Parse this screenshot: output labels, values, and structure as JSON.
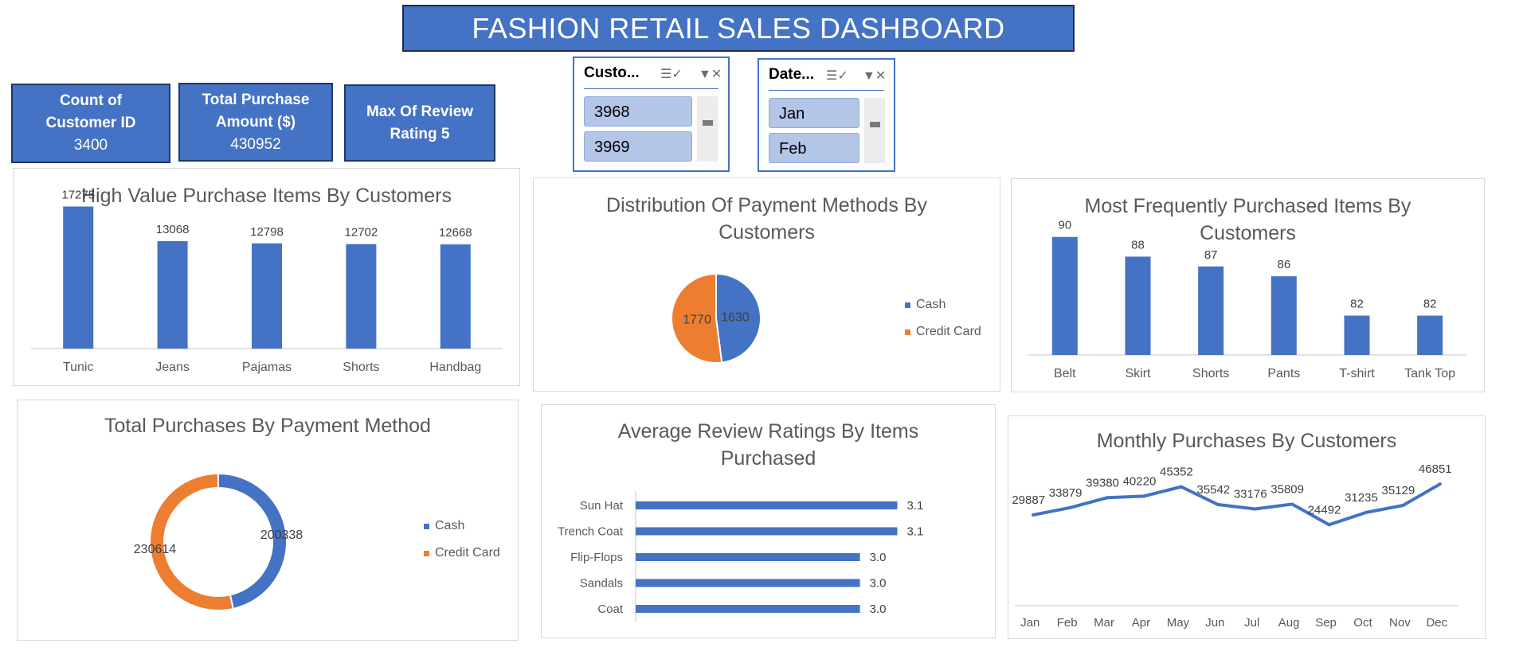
{
  "header": {
    "title": "FASHION RETAIL SALES DASHBOARD"
  },
  "kpis": [
    {
      "line1": "Count of",
      "line2": "Customer ID",
      "value": "3400"
    },
    {
      "line1": "Total Purchase",
      "line2": "Amount ($)",
      "value": "430952"
    },
    {
      "line1": "Max Of Review",
      "line2": "Rating  5"
    }
  ],
  "slicers": [
    {
      "title": "Custo...",
      "items": [
        "3968",
        "3969"
      ]
    },
    {
      "title": "Date...",
      "items": [
        "Jan",
        "Feb"
      ]
    }
  ],
  "icons": [
    "multi-select-icon",
    "clear-filter-icon"
  ],
  "colors": {
    "blue": "#4472c4",
    "orange": "#ed7d31",
    "slicer_item": "#b4c6e7"
  },
  "chart_data": [
    {
      "id": "high-value",
      "type": "bar",
      "title": "High Value Purchase Items By Customers",
      "categories": [
        "Tunic",
        "Jeans",
        "Pajamas",
        "Shorts",
        "Handbag"
      ],
      "values": [
        17275,
        13068,
        12798,
        12702,
        12668
      ],
      "ylim": [
        0,
        18000
      ]
    },
    {
      "id": "payment-dist",
      "type": "pie",
      "title_lines": [
        "Distribution Of Payment Methods By",
        "Customers"
      ],
      "labels": [
        "Cash",
        "Credit Card"
      ],
      "values": [
        1630,
        1770
      ],
      "legend": "right"
    },
    {
      "id": "frequent-items",
      "type": "bar",
      "title_lines": [
        "Most Frequently Purchased Items By",
        "Customers"
      ],
      "categories": [
        "Belt",
        "Skirt",
        "Shorts",
        "Pants",
        "T-shirt",
        "Tank Top"
      ],
      "values": [
        90,
        88,
        87,
        86,
        82,
        82
      ],
      "ylim": [
        78,
        92
      ]
    },
    {
      "id": "payment-totals",
      "type": "pie",
      "subtype": "donut",
      "title": "Total Purchases By Payment Method",
      "labels": [
        "Cash",
        "Credit Card"
      ],
      "values": [
        200338,
        230614
      ],
      "legend": "right"
    },
    {
      "id": "avg-ratings",
      "type": "bar",
      "orientation": "horizontal",
      "title_lines": [
        "Average Review Ratings By Items",
        "Purchased"
      ],
      "categories": [
        "Sun Hat",
        "Trench Coat",
        "Flip-Flops",
        "Sandals",
        "Coat"
      ],
      "values": [
        3.1,
        3.1,
        3.0,
        3.0,
        3.0
      ],
      "value_labels": [
        "3.1",
        "3.1",
        "3.0",
        "3.0",
        "3.0"
      ],
      "xlim": [
        2.4,
        3.15
      ]
    },
    {
      "id": "monthly",
      "type": "line",
      "title": "Monthly Purchases By Customers",
      "categories": [
        "Jan",
        "Feb",
        "Mar",
        "Apr",
        "May",
        "Jun",
        "Jul",
        "Aug",
        "Sep",
        "Oct",
        "Nov",
        "Dec"
      ],
      "values": [
        29887,
        33879,
        39380,
        40220,
        45352,
        35542,
        33176,
        35809,
        24492,
        31235,
        35129,
        46851
      ],
      "ylim": [
        -20000,
        50000
      ]
    }
  ]
}
